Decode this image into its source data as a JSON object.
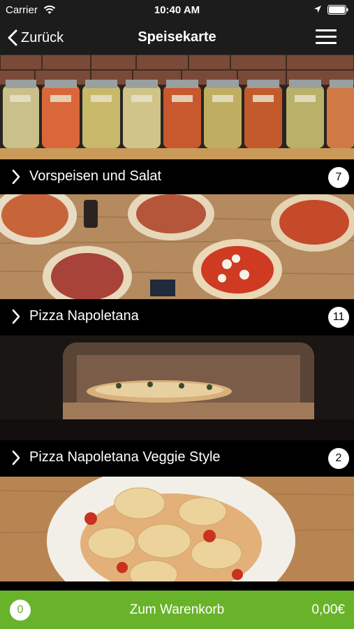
{
  "status_bar": {
    "carrier": "Carrier",
    "time": "10:40 AM",
    "icons": [
      "wifi-icon",
      "location-icon",
      "battery-icon"
    ]
  },
  "nav": {
    "back_label": "Zurück",
    "title": "Speisekarte",
    "menu_icon": "hamburger-menu-icon"
  },
  "categories": [
    {
      "label": "Vorspeisen und Salat",
      "count": "7",
      "image": "jars-of-pickled-vegetables"
    },
    {
      "label": "Pizza Napoletana",
      "count": "11",
      "image": "pizzas-on-wooden-table"
    },
    {
      "label": "Pizza Napoletana Veggie Style",
      "count": "2",
      "image": "pizza-in-oven"
    },
    {
      "label": "",
      "count": "",
      "image": "ravioli-plate"
    }
  ],
  "cart": {
    "count": "0",
    "label": "Zum Warenkorb",
    "total": "0,00€"
  },
  "colors": {
    "bar_background": "#1c1c1c",
    "cart_green": "#69b32a"
  }
}
